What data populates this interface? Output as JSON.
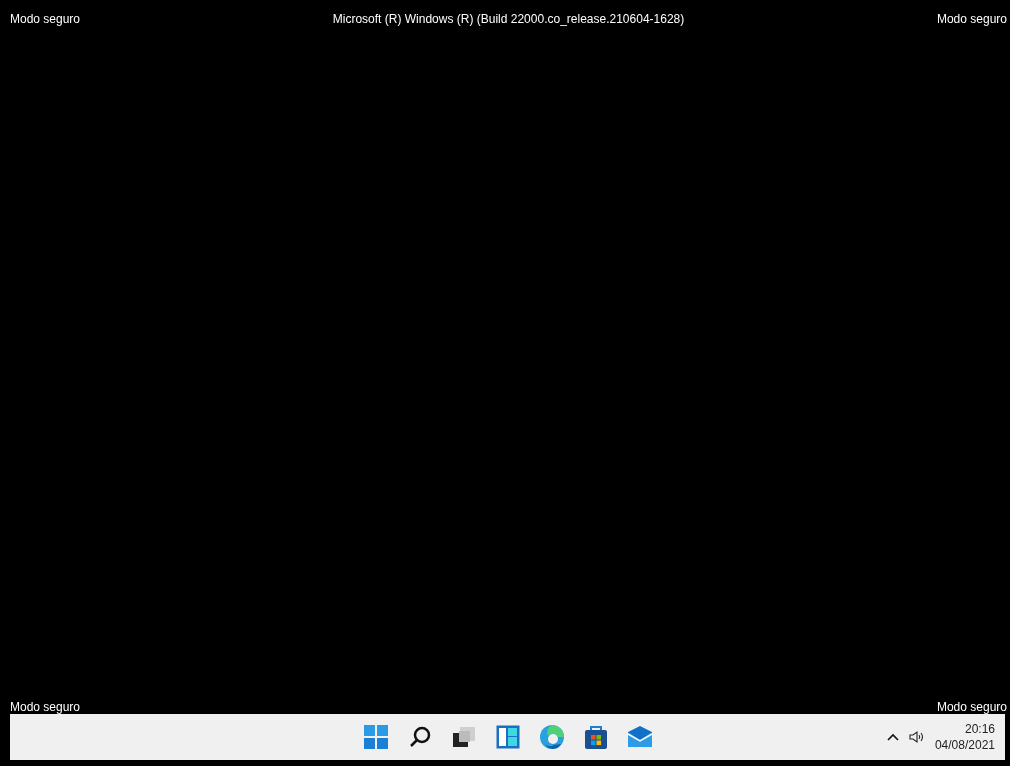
{
  "top_bar": {
    "left": "Modo seguro",
    "center": "Microsoft (R) Windows (R) (Build 22000.co_release.210604-1628)",
    "right": "Modo seguro"
  },
  "bottom_bar": {
    "left": "Modo seguro",
    "right": "Modo seguro"
  },
  "taskbar": {
    "apps": [
      {
        "kind": "start"
      },
      {
        "kind": "search"
      },
      {
        "kind": "taskview"
      },
      {
        "kind": "widgets"
      },
      {
        "kind": "browser"
      },
      {
        "kind": "store"
      },
      {
        "kind": "mail"
      }
    ],
    "tray": {
      "time": "20:16",
      "date": "04/08/2021"
    }
  }
}
